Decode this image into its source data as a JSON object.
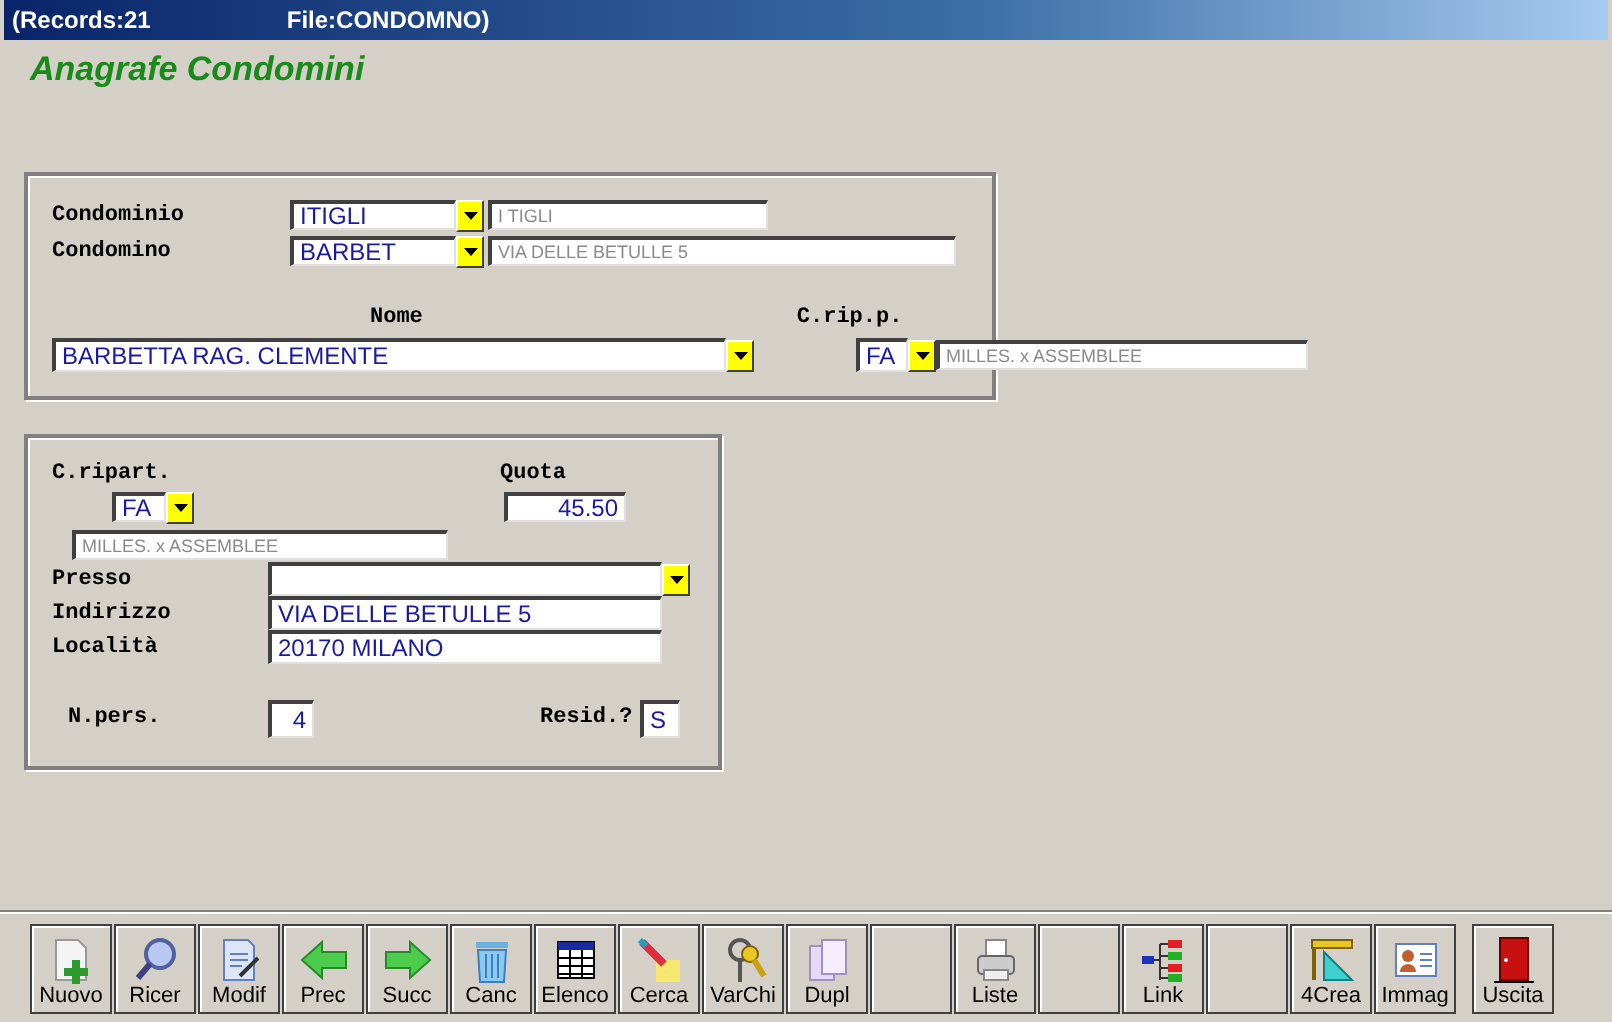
{
  "title_bar": {
    "records": "(Records:21",
    "file": "File:CONDOMNO)"
  },
  "form_title": "Anagrafe Condomini",
  "panel_1": {
    "condominio": {
      "label": "Condominio",
      "code": "ITIGLI",
      "description": "I TIGLI"
    },
    "condomino": {
      "label": "Condomino",
      "code": "BARBET",
      "description": "VIA DELLE BETULLE 5"
    },
    "nome": {
      "label": "Nome",
      "value": "BARBETTA RAG. CLEMENTE"
    },
    "c_rip_p": {
      "label": "C.rip.p.",
      "code": "FA",
      "description": "MILLES. x ASSEMBLEE"
    }
  },
  "panel_2": {
    "c_ripart": {
      "label": "C.ripart.",
      "code": "FA",
      "description": "MILLES. x ASSEMBLEE"
    },
    "quota": {
      "label": "Quota",
      "value": "45.50"
    },
    "presso": {
      "label": "Presso"
    },
    "indirizzo": {
      "label": "Indirizzo",
      "value": "VIA DELLE BETULLE 5"
    },
    "localita": {
      "label": "Località",
      "value": "20170 MILANO"
    },
    "n_pers": {
      "label": "N.pers.",
      "value": "4"
    },
    "resid": {
      "label": "Resid.?",
      "value": "S"
    }
  },
  "toolbar": [
    {
      "kind": "new",
      "label": "Nuovo"
    },
    {
      "kind": "search",
      "label": "Ricer"
    },
    {
      "kind": "edit",
      "label": "Modif"
    },
    {
      "kind": "prev",
      "label": "Prec"
    },
    {
      "kind": "next",
      "label": "Succ"
    },
    {
      "kind": "trash",
      "label": "Canc"
    },
    {
      "kind": "table",
      "label": "Elenco"
    },
    {
      "kind": "marker",
      "label": "Cerca"
    },
    {
      "kind": "keys",
      "label": "VarChi"
    },
    {
      "kind": "copy",
      "label": "Dupl"
    },
    {
      "kind": "blank"
    },
    {
      "kind": "printer",
      "label": "Liste"
    },
    {
      "kind": "blank"
    },
    {
      "kind": "tree",
      "label": "Link"
    },
    {
      "kind": "blank"
    },
    {
      "kind": "ruler",
      "label": "4Crea"
    },
    {
      "kind": "card",
      "label": "Immag"
    },
    {
      "kind": "exit",
      "label": "Uscita"
    }
  ]
}
